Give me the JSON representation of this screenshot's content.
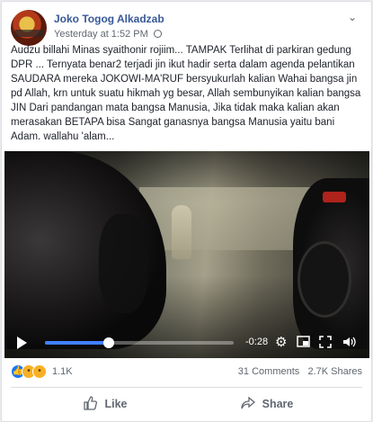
{
  "post": {
    "author": "Joko Togog Alkadzab",
    "timestamp": "Yesterday at 1:52 PM",
    "text": "Audzu billahi Minas syaithonir rojiim... TAMPAK Terlihat di parkiran gedung DPR ... Ternyata benar2 terjadi jin ikut hadir serta dalam agenda pelantikan SAUDARA mereka JOKOWI-MA'RUF bersyukurlah kalian Wahai bangsa jin pd Allah, krn untuk suatu hikmah yg besar, Allah sembunyikan kalian bangsa JIN Dari pandangan mata bangsa Manusia, Jika tidak maka kalian akan merasakan BETAPA bisa Sangat ganasnya bangsa Manusia yaitu bani Adam. wallahu 'alam..."
  },
  "video": {
    "time_remaining": "-0:28",
    "progress": 0.34,
    "icons": [
      "play-icon",
      "settings-gear-icon",
      "picture-in-picture-icon",
      "fullscreen-icon",
      "volume-icon"
    ]
  },
  "engagement": {
    "reaction_count": "1.1K",
    "comments": "31 Comments",
    "shares": "2.7K Shares",
    "reactions": [
      "like",
      "wow",
      "haha"
    ]
  },
  "actions": {
    "like_label": "Like",
    "share_label": "Share"
  },
  "colors": {
    "author_link": "#385898",
    "progress_fill": "#4080ff",
    "like_reaction": "#1877f2"
  }
}
